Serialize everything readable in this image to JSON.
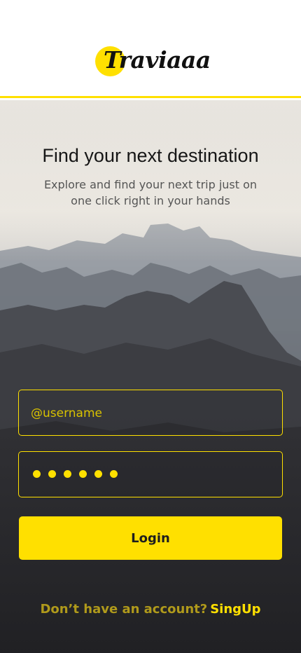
{
  "brand": {
    "name": "Traviaaa",
    "accent_color": "#FFE000"
  },
  "hero": {
    "title": "Find your next destination",
    "subtitle": "Explore and find your next trip just on one click right in your hands"
  },
  "form": {
    "username_placeholder": "@username",
    "password_masked_length": 6,
    "login_label": "Login"
  },
  "signup": {
    "prompt": "Don’t have an account?",
    "link_label": "SingUp"
  }
}
